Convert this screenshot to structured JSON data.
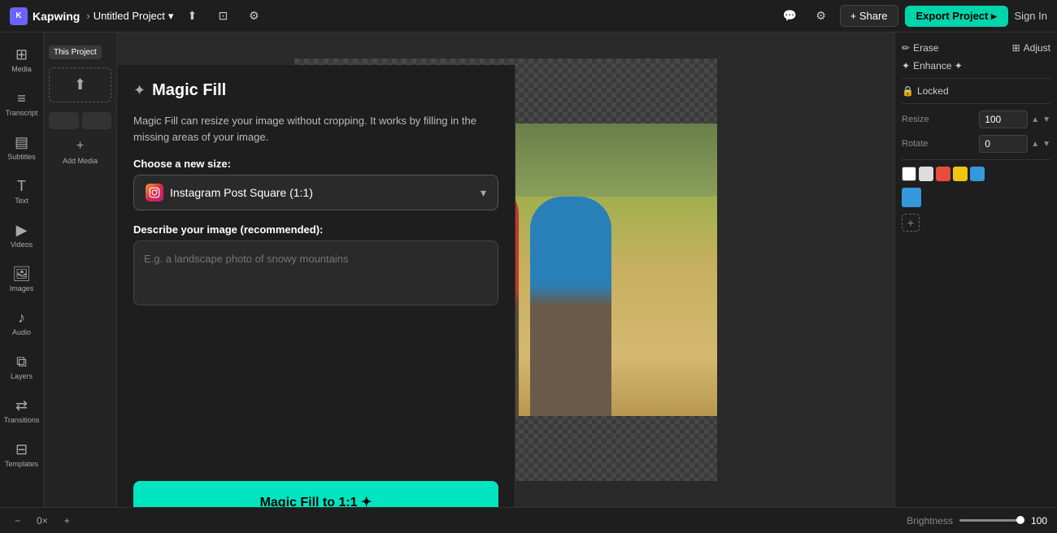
{
  "app": {
    "name": "Kapwing",
    "breadcrumb_sep": "›",
    "project_name": "Untitled Project",
    "project_name_chevron": "▾"
  },
  "topbar": {
    "share_label": "+ Share",
    "export_label": "Export Project ▸",
    "signin_label": "Sign In"
  },
  "left_sidebar": {
    "items": [
      {
        "id": "media",
        "icon": "⊞",
        "label": "Media"
      },
      {
        "id": "transcript",
        "icon": "≡",
        "label": "Transcript"
      },
      {
        "id": "subtitles",
        "icon": "▤",
        "label": "Subtitles"
      },
      {
        "id": "text",
        "icon": "T",
        "label": "Text"
      },
      {
        "id": "videos",
        "icon": "▶",
        "label": "Videos"
      },
      {
        "id": "images",
        "icon": "🖼",
        "label": "Images"
      },
      {
        "id": "audio",
        "icon": "♪",
        "label": "Audio"
      },
      {
        "id": "layers",
        "icon": "⧉",
        "label": "Layers"
      },
      {
        "id": "transitions",
        "icon": "⇄",
        "label": "Transitions"
      },
      {
        "id": "templates",
        "icon": "⊟",
        "label": "Templates"
      }
    ]
  },
  "media_panel": {
    "tabs": [
      {
        "id": "this-project",
        "label": "This Project",
        "active": true
      }
    ],
    "upload_icon": "⬆",
    "upload_label": "",
    "add_media_icon": "+",
    "add_media_label": "Add Media"
  },
  "right_sidebar": {
    "erase_label": "Erase",
    "adjust_label": "Adjust",
    "enhance_label": "Enhance ✦",
    "locked_label": "Locked",
    "resize_label": "Resize",
    "resize_value": "100",
    "rotate_label": "Rotate",
    "rotate_value": "0",
    "colors": [
      {
        "hex": "#ffffff"
      },
      {
        "hex": "#dddddd"
      },
      {
        "hex": "#e74c3c"
      },
      {
        "hex": "#f1c40f"
      },
      {
        "hex": "#3498db"
      }
    ],
    "brightness_label": "Brightness",
    "brightness_value": "100"
  },
  "magic_fill": {
    "title": "Magic Fill",
    "wand_icon": "✦",
    "description": "Magic Fill can resize your image without cropping. It works by filling in the missing areas of your image.",
    "size_section_label": "Choose a new size:",
    "size_option_icon": "ig",
    "size_option_label": "Instagram Post Square (1:1)",
    "describe_section_label": "Describe your image (recommended):",
    "textarea_placeholder": "E.g. a landscape photo of snowy mountains",
    "cta_label": "Magic Fill to 1:1 ✦"
  },
  "bottom_bar": {
    "zoom_out_icon": "−",
    "zoom_in_icon": "+",
    "zoom_value": "0×",
    "brightness_label": "Brightness",
    "brightness_value": "100"
  }
}
